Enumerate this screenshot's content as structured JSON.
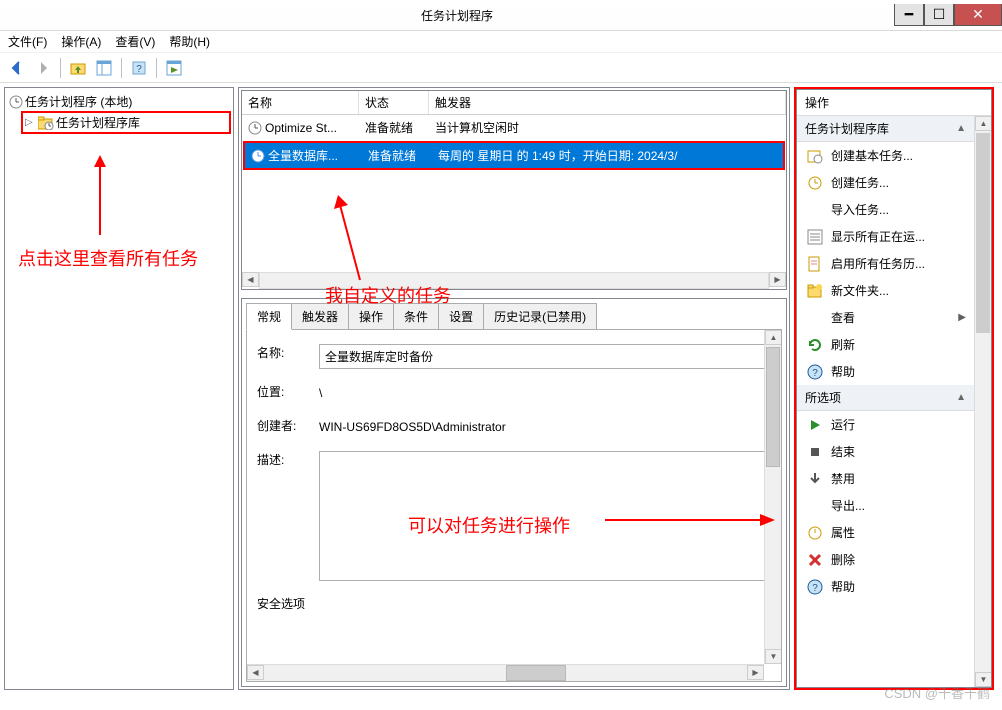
{
  "window": {
    "title": "任务计划程序"
  },
  "menu": {
    "file": "文件(F)",
    "action": "操作(A)",
    "view": "查看(V)",
    "help": "帮助(H)"
  },
  "tree": {
    "root": "任务计划程序 (本地)",
    "library": "任务计划程序库"
  },
  "grid": {
    "headers": {
      "name": "名称",
      "status": "状态",
      "trigger": "触发器"
    },
    "rows": [
      {
        "name": "Optimize St...",
        "status": "准备就绪",
        "trigger": "当计算机空闲时"
      },
      {
        "name": "全量数据库...",
        "status": "准备就绪",
        "trigger": "每周的 星期日 的 1:49 时，开始日期: 2024/3/"
      }
    ]
  },
  "tabs": {
    "general": "常规",
    "triggers": "触发器",
    "actions": "操作",
    "conditions": "条件",
    "settings": "设置",
    "history": "历史记录(已禁用)"
  },
  "detail": {
    "name_label": "名称:",
    "name_value": "全量数据库定时备份",
    "location_label": "位置:",
    "location_value": "\\",
    "creator_label": "创建者:",
    "creator_value": "WIN-US69FD8OS5D\\Administrator",
    "description_label": "描述:",
    "security_label": "安全选项"
  },
  "actions_panel": {
    "header": "操作",
    "group1": "任务计划程序库",
    "items1": [
      "创建基本任务...",
      "创建任务...",
      "导入任务...",
      "显示所有正在运...",
      "启用所有任务历...",
      "新文件夹...",
      "查看",
      "刷新",
      "帮助"
    ],
    "group2": "所选项",
    "items2": [
      "运行",
      "结束",
      "禁用",
      "导出...",
      "属性",
      "删除",
      "帮助"
    ]
  },
  "annotations": {
    "a1": "点击这里查看所有任务",
    "a2": "我自定义的任务",
    "a3": "可以对任务进行操作"
  },
  "watermark": "CSDN @千香千鹤"
}
